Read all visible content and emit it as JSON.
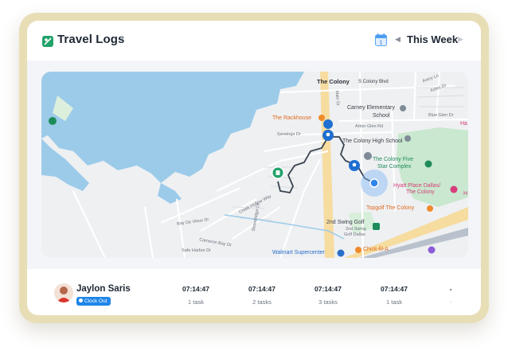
{
  "header": {
    "title": "Travel Logs",
    "calendar_day": "1",
    "week_label": "This Week"
  },
  "map": {
    "labels": {
      "the_colony": "The Colony",
      "colony_blvd": "S Colony Blvd",
      "avery_ln": "Avery Ln",
      "aztec_dr": "Aztec Dr",
      "carney": "Carney Elementary",
      "school": "School",
      "blue_glen": "Blue Glen Dr",
      "arbor_glen": "Arbor Glen Rd",
      "rackhouse": "The Rackhouse",
      "colony_high": "The Colony High School",
      "saratoga": "Saratoga Dr",
      "five_star_1": "The Colony Five",
      "five_star_2": "Star Complex",
      "hyatt_1": "Hyatt Place Dallas/",
      "hyatt_2": "The Colony",
      "topgolf": "Topgolf The Colony",
      "swing_golf": "2nd Swing Golf",
      "swing_golf_sub1": "2nd Swing",
      "swing_golf_sub2": "Golf Dallas",
      "chickfila": "Chick-fil-A",
      "walmart": "Walmart Supercenter",
      "creek_hollow": "Creek Hollow Way",
      "bay_de_vieux": "Bay De Vieux Dr",
      "cameron_bay": "Cameron Bay Dr",
      "safe_harbor": "Safe Harbor Dr",
      "strandridge": "Strandridge Dr",
      "main_st": "Main St",
      "ha": "Ha",
      "h": "H"
    }
  },
  "employee": {
    "name": "Jaylon Saris",
    "status": "Clock Out",
    "days": [
      {
        "time": "07:14:47",
        "tasks": "1 task"
      },
      {
        "time": "07:14:47",
        "tasks": "2 tasks"
      },
      {
        "time": "07:14:47",
        "tasks": "3 tasks"
      },
      {
        "time": "07:14:47",
        "tasks": "1 task"
      },
      {
        "time": "-",
        "tasks": "-"
      }
    ]
  },
  "colors": {
    "accent": "#1f86e8",
    "frame": "#e8deb6",
    "water": "#9ccbea",
    "park": "#c9e8cf",
    "highway": "#f7dca0",
    "route": "#3a4350",
    "logo_green": "#22a36b"
  }
}
